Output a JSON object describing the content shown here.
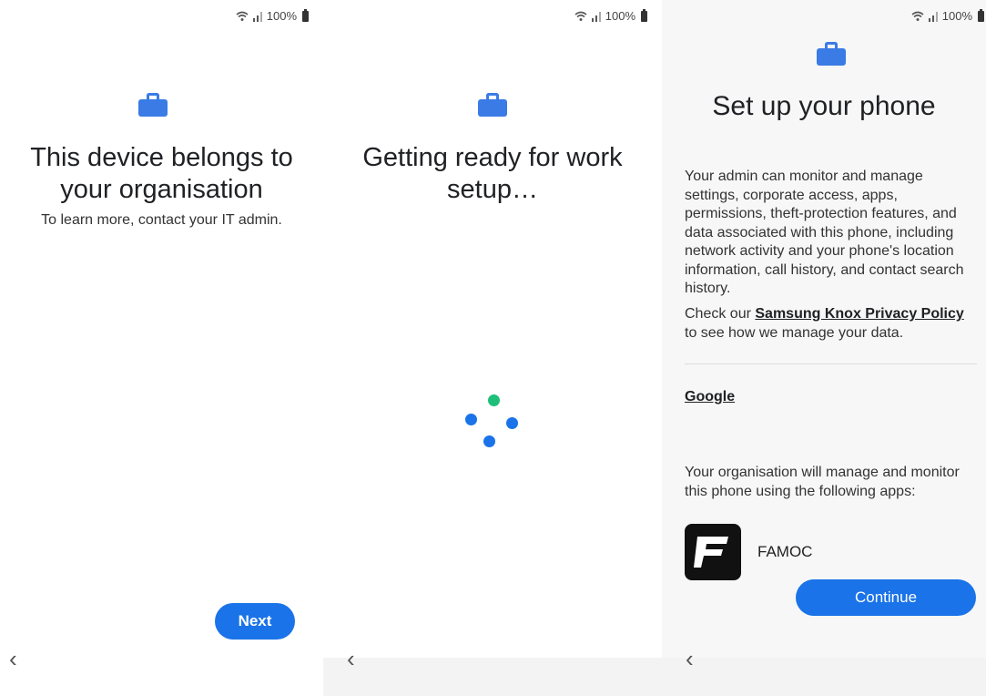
{
  "status_bar": {
    "battery": "100%"
  },
  "panel1": {
    "title": "This device belongs to your organisation",
    "subtitle": "To learn more, contact your IT admin.",
    "next_label": "Next",
    "back_icon": "‹"
  },
  "panel2": {
    "title": "Getting ready for work setup…",
    "back_icon": "‹"
  },
  "panel3": {
    "title": "Set up your phone",
    "description": "Your admin can monitor and manage settings, corporate access, apps, permissions, theft-protection features, and data associated with this phone, including network activity and your phone's location information, call history, and contact search history.",
    "privacy_prefix": "Check our ",
    "privacy_link": "Samsung Knox Privacy Policy",
    "privacy_suffix": " to see how we manage your data.",
    "google_link": "Google",
    "apps_intro": "Your organisation will manage and monitor this phone using the following apps:",
    "app_name": "FAMOC",
    "continue_label": "Continue",
    "back_icon": "‹"
  },
  "colors": {
    "accent": "#1a73e8",
    "briefcase": "#3a7be6",
    "spinner_green": "#1fbf7a"
  },
  "icons": [
    "wifi-icon",
    "signal-icon",
    "battery-icon",
    "briefcase-icon",
    "back-icon",
    "famoc-logo-icon"
  ]
}
